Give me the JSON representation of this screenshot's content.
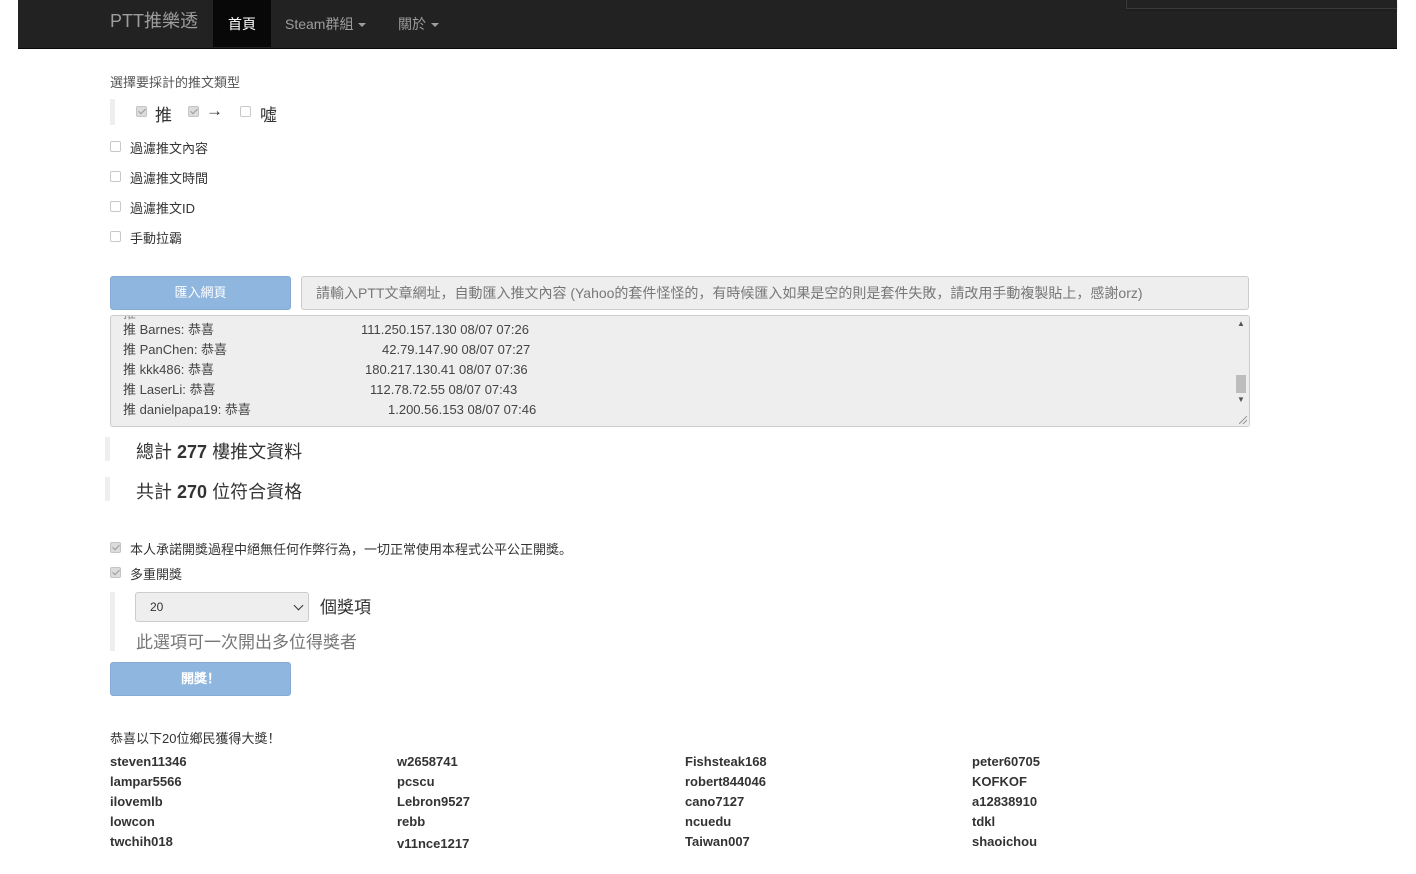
{
  "navbar": {
    "brand": "PTT推樂透",
    "home": "首頁",
    "steam": "Steam群組",
    "about": "關於"
  },
  "form": {
    "type_label": "選擇要採計的推文類型",
    "types": [
      {
        "label": "推",
        "checked": true
      },
      {
        "label": "→",
        "checked": true
      },
      {
        "label": "噓",
        "checked": false
      }
    ],
    "filters": [
      {
        "label": "過濾推文內容",
        "checked": false
      },
      {
        "label": "過濾推文時間",
        "checked": false
      },
      {
        "label": "過濾推文ID",
        "checked": false
      },
      {
        "label": "手動拉霸",
        "checked": false
      }
    ],
    "import_button": "匯入網頁",
    "url_placeholder": "請輸入PTT文章網址，自動匯入推文內容 (Yahoo的套件怪怪的，有時候匯入如果是空的則是套件失敗，請改用手動複製貼上，感謝orz)"
  },
  "pushes": [
    {
      "text": "推 Barnes: 恭喜",
      "meta": "111.250.157.130 08/07 07:26"
    },
    {
      "text": "推 PanChen: 恭喜",
      "meta": "42.79.147.90 08/07 07:27"
    },
    {
      "text": "推 kkk486: 恭喜",
      "meta": "180.217.130.41 08/07 07:36"
    },
    {
      "text": "推 LaserLi: 恭喜",
      "meta": "112.78.72.55 08/07 07:43"
    },
    {
      "text": "推 danielpapa19: 恭喜",
      "meta": "1.200.56.153 08/07 07:46"
    }
  ],
  "stats": {
    "total_prefix": "總計",
    "total_count": "277",
    "total_suffix": "樓推文資料",
    "eligible_prefix": "共計",
    "eligible_count": "270",
    "eligible_suffix": "位符合資格"
  },
  "draw": {
    "pledge_label": "本人承諾開獎過程中絕無任何作弊行為，一切正常使用本程式公平公正開獎。",
    "pledge_checked": true,
    "multi_label": "多重開獎",
    "multi_checked": true,
    "prize_count": "20",
    "prize_unit": "個獎項",
    "prize_help": "此選項可一次開出多位得獎者",
    "draw_button": "開獎！"
  },
  "results": {
    "heading": "恭喜以下20位鄉民獲得大獎！",
    "columns": [
      [
        "steven11346",
        "lampar5566",
        "ilovemlb",
        "lowcon",
        "twchih018"
      ],
      [
        "w2658741",
        "pcscu",
        "Lebron9527",
        "rebb",
        "v11nce1217"
      ],
      [
        "Fishsteak168",
        "robert844046",
        "cano7127",
        "ncuedu",
        "Taiwan007"
      ],
      [
        "peter60705",
        "KOFKOF",
        "a12838910",
        "tdkl",
        "shaoichou"
      ]
    ]
  }
}
